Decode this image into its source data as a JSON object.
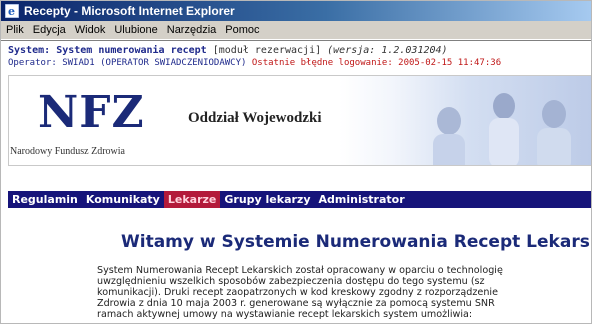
{
  "window": {
    "title": "Recepty - Microsoft Internet Explorer"
  },
  "menu": [
    {
      "label": "Plik"
    },
    {
      "label": "Edycja"
    },
    {
      "label": "Widok"
    },
    {
      "label": "Ulubione"
    },
    {
      "label": "Narzędzia"
    },
    {
      "label": "Pomoc"
    }
  ],
  "header": {
    "system_label": "System:",
    "system_name": "System numerowania recept",
    "module": "[moduł rezerwacji]",
    "version": "(wersja: 1.2.031204)",
    "operator_label": "Operator:",
    "operator": "SWIAD1 (OPERATOR SWIADCZENIODAWCY)",
    "last_login": "Ostatnie błędne logowanie: 2005-02-15 11:47:36"
  },
  "banner": {
    "logo": "NFZ",
    "org": "Narodowy Fundusz Zdrowia",
    "branch": "Oddział Wojewodzki"
  },
  "nav": [
    {
      "label": "Regulamin",
      "active": false
    },
    {
      "label": "Komunikaty",
      "active": false
    },
    {
      "label": "Lekarze",
      "active": true
    },
    {
      "label": "Grupy lekarzy",
      "active": false
    },
    {
      "label": "Administrator",
      "active": false
    }
  ],
  "main": {
    "heading": "Witamy w Systemie Numerowania Recept Lekarski",
    "body_lines": [
      "System Numerowania Recept Lekarskich został opracowany w oparciu o technologię",
      "uwzględnieniu wszelkich sposobów zabezpieczenia dostępu do tego systemu (sz",
      "komunikacji). Druki recept zaopatrzonych w kod kreskowy zgodny z rozporządzenie",
      "Zdrowia z dnia 10 maja 2003 r. generowane są wyłącznie za pomocą systemu SNR",
      "ramach aktywnej umowy na wystawianie recept lekarskich system umożliwia:"
    ]
  },
  "colors": {
    "nav_bg": "#16147a",
    "nav_active": "#b31a3a",
    "title_bar": "#0a246a",
    "heading": "#1b2a78"
  }
}
